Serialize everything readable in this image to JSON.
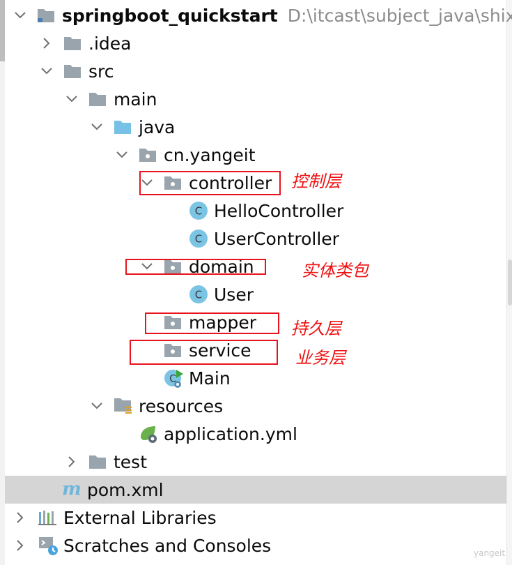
{
  "project": {
    "name": "springboot_quickstart",
    "path": "D:\\itcast\\subject_java\\shixu"
  },
  "tree": {
    "idea": ".idea",
    "src": "src",
    "main": "main",
    "java": "java",
    "package": "cn.yangeit",
    "controller": "controller",
    "hello_controller": "HelloController",
    "user_controller": "UserController",
    "domain": "domain",
    "user": "User",
    "mapper": "mapper",
    "service": "service",
    "main_class": "Main",
    "resources": "resources",
    "application_yml": "application.yml",
    "test": "test",
    "pom": "pom.xml",
    "external_libraries": "External Libraries",
    "scratches": "Scratches and Consoles"
  },
  "annotations": {
    "controller": "控制层",
    "domain": "实体类包",
    "mapper": "持久层",
    "service": "业务层"
  },
  "watermark": "yangeit",
  "colors": {
    "folder_gray": "#9aa4ac",
    "folder_blue": "#77c1e6",
    "class_circle": "#7cc4e4",
    "annotation_red": "#e8131c",
    "selected_row": "#d5d5d5"
  },
  "selected_item": "pom.xml"
}
